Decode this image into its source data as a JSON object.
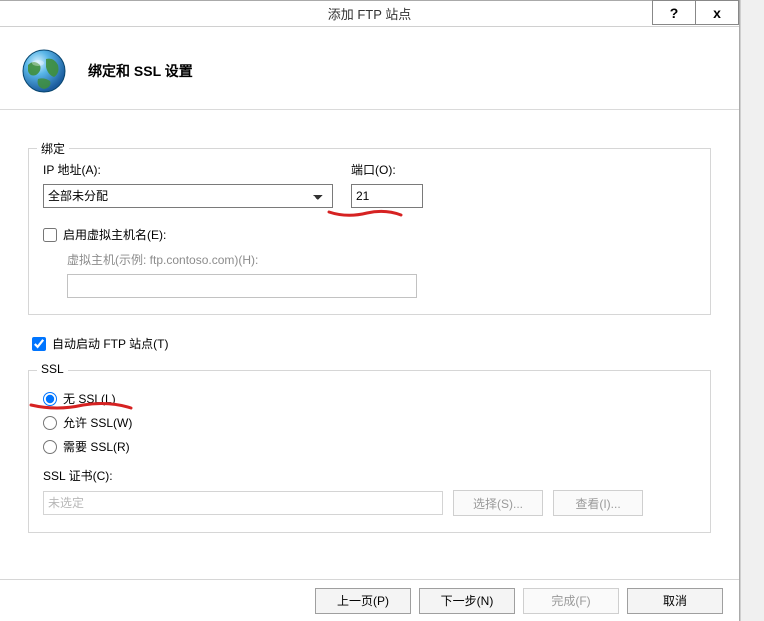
{
  "titlebar": {
    "title": "添加 FTP 站点",
    "help": "?",
    "close": "x"
  },
  "header": {
    "title": "绑定和 SSL 设置"
  },
  "binding": {
    "legend": "绑定",
    "ip_label": "IP 地址(A):",
    "ip_value": "全部未分配",
    "port_label": "端口(O):",
    "port_value": "21",
    "enable_vhost_label": "启用虚拟主机名(E):",
    "enable_vhost_checked": false,
    "vhost_label": "虚拟主机(示例: ftp.contoso.com)(H):",
    "vhost_value": ""
  },
  "autostart": {
    "label": "自动启动 FTP 站点(T)",
    "checked": true
  },
  "ssl": {
    "legend": "SSL",
    "no_ssl": "无 SSL(L)",
    "allow_ssl": "允许 SSL(W)",
    "require_ssl": "需要 SSL(R)",
    "selected": "no_ssl",
    "cert_label": "SSL 证书(C):",
    "cert_value": "未选定",
    "select_btn": "选择(S)...",
    "view_btn": "查看(I)..."
  },
  "footer": {
    "prev": "上一页(P)",
    "next": "下一步(N)",
    "finish": "完成(F)",
    "cancel": "取消"
  }
}
